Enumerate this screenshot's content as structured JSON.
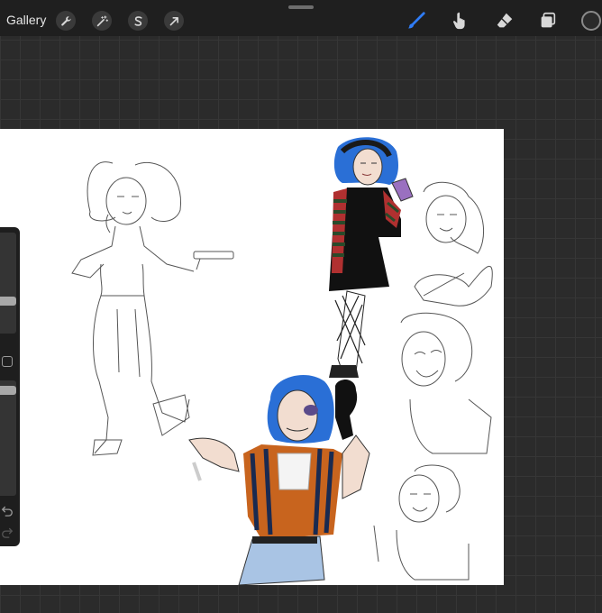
{
  "toolbar": {
    "gallery_label": "Gallery",
    "left_tools": [
      {
        "name": "actions",
        "icon": "wrench-icon"
      },
      {
        "name": "adjustments",
        "icon": "magic-wand-icon"
      },
      {
        "name": "selection",
        "icon": "selection-s-icon"
      },
      {
        "name": "transform",
        "icon": "arrow-cursor-icon"
      }
    ],
    "right_tools": [
      {
        "name": "brush",
        "icon": "brush-icon",
        "active": true
      },
      {
        "name": "smudge",
        "icon": "smudge-icon",
        "active": false
      },
      {
        "name": "eraser",
        "icon": "eraser-icon",
        "active": false
      },
      {
        "name": "layers",
        "icon": "layers-icon",
        "active": false
      }
    ],
    "active_color": "#2a2a2a",
    "accent_color": "#2f7cf6"
  },
  "sidebar": {
    "brush_size_level": 0.3,
    "opacity_level": 0.05,
    "modify_icon": "square-icon",
    "undo_icon": "undo-icon",
    "redo_icon": "redo-icon"
  }
}
